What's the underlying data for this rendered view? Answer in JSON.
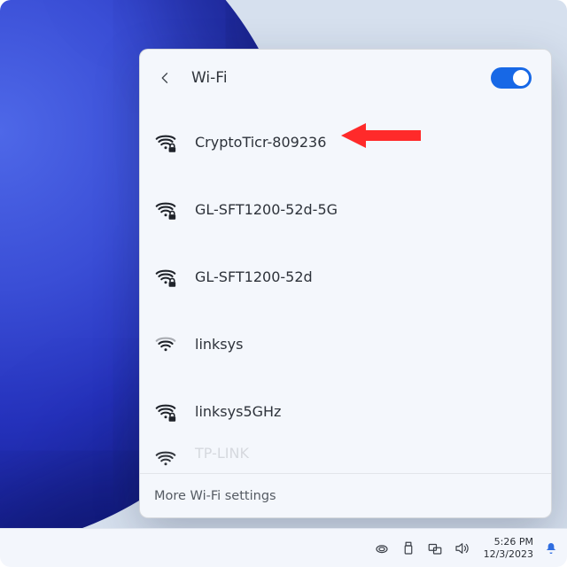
{
  "header": {
    "title": "Wi-Fi",
    "toggle_on": true
  },
  "networks": [
    {
      "ssid": "CryptoTicr-809236",
      "secured": true,
      "strength": 4
    },
    {
      "ssid": "GL-SFT1200-52d-5G",
      "secured": true,
      "strength": 4
    },
    {
      "ssid": "GL-SFT1200-52d",
      "secured": true,
      "strength": 4
    },
    {
      "ssid": "linksys",
      "secured": false,
      "strength": 3
    },
    {
      "ssid": "linksys5GHz",
      "secured": true,
      "strength": 4
    }
  ],
  "cutoff_network": {
    "ssid": "TP-LINK",
    "secured": true
  },
  "footer": {
    "more_settings": "More Wi-Fi settings"
  },
  "taskbar": {
    "time": "5:26 PM",
    "date": "12/3/2023"
  },
  "annotation": {
    "arrow_color": "#ff2a2a"
  }
}
